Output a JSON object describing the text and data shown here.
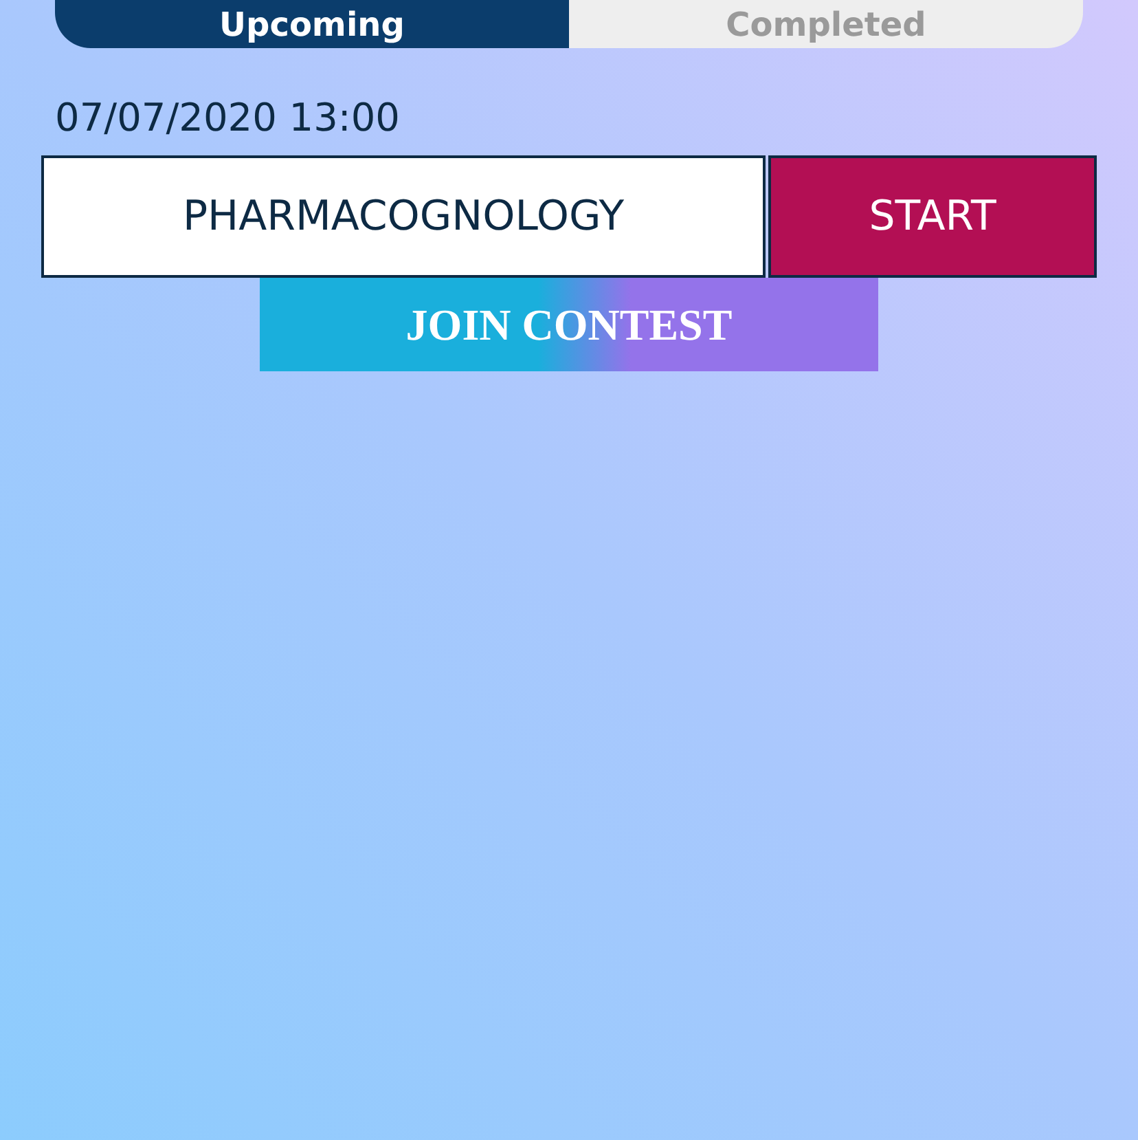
{
  "tabs": [
    {
      "label": "Upcoming",
      "selected": true
    },
    {
      "label": "Completed",
      "selected": false
    }
  ],
  "contests": [
    {
      "datetime": "07/07/2020 13:00",
      "subject": "PHARMACOGNOLOGY",
      "start_button": "START",
      "join_button": "JOIN CONTEST"
    }
  ]
}
